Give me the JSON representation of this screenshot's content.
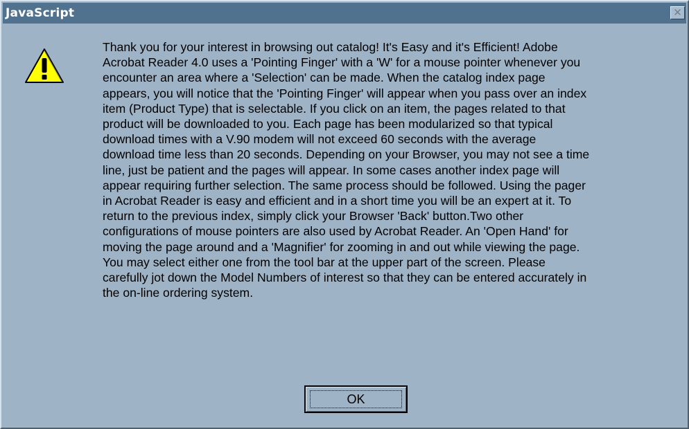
{
  "dialog": {
    "title": "JavaScript",
    "close_glyph": "✕",
    "icon": "warning-icon",
    "message": "Thank you for your interest in browsing out catalog!  It's Easy and it's Efficient! Adobe\nAcrobat Reader 4.0 uses a 'Pointing Finger' with a 'W' for a mouse pointer whenever you\nencounter an area where a 'Selection' can be made.  When the catalog index page\nappears, you will notice that the 'Pointing Finger' will appear when you pass over an index\nitem (Product Type) that is selectable.  If you click on an item, the pages related to that\nproduct will be downloaded to you.  Each page has been modularized so that typical\ndownload times with a V.90 modem will not exceed 60 seconds with the average\ndownload time less than 20 seconds.  Depending on your Browser, you may not see a time\nline, just be patient and the pages will appear.  In some cases another index page will\nappear requiring further selection.  The same process should be followed.  Using the pager\nin Acrobat Reader is easy and efficient and in a short time you will be an expert at it.  To\nreturn to the previous index, simply click your Browser 'Back' button.Two other\nconfigurations of mouse pointers are also used by Acrobat Reader.  An 'Open Hand' for\nmoving the page around and a 'Magnifier' for zooming in and out while viewing the page.\nYou may select either one from the tool bar at the upper part of the screen.  Please\ncarefully jot down the Model Numbers of interest so that they can be entered accurately in\nthe on-line ordering system.",
    "ok_label": "OK"
  },
  "colors": {
    "dialog_background": "#9fb3c6",
    "titlebar": "#50728f",
    "title_text": "#ffffff",
    "warning_fill": "#ffff00"
  }
}
